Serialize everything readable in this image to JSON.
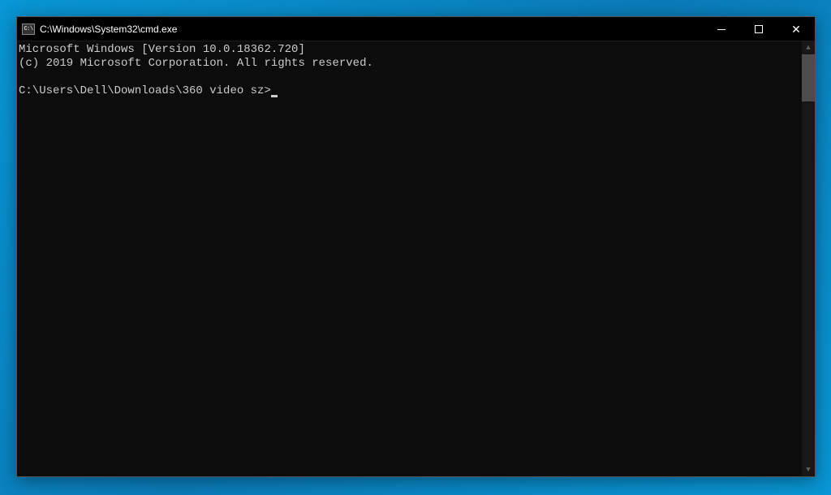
{
  "window": {
    "title": "C:\\Windows\\System32\\cmd.exe"
  },
  "terminal": {
    "line1": "Microsoft Windows [Version 10.0.18362.720]",
    "line2": "(c) 2019 Microsoft Corporation. All rights reserved.",
    "prompt": "C:\\Users\\Dell\\Downloads\\360 video sz>"
  }
}
